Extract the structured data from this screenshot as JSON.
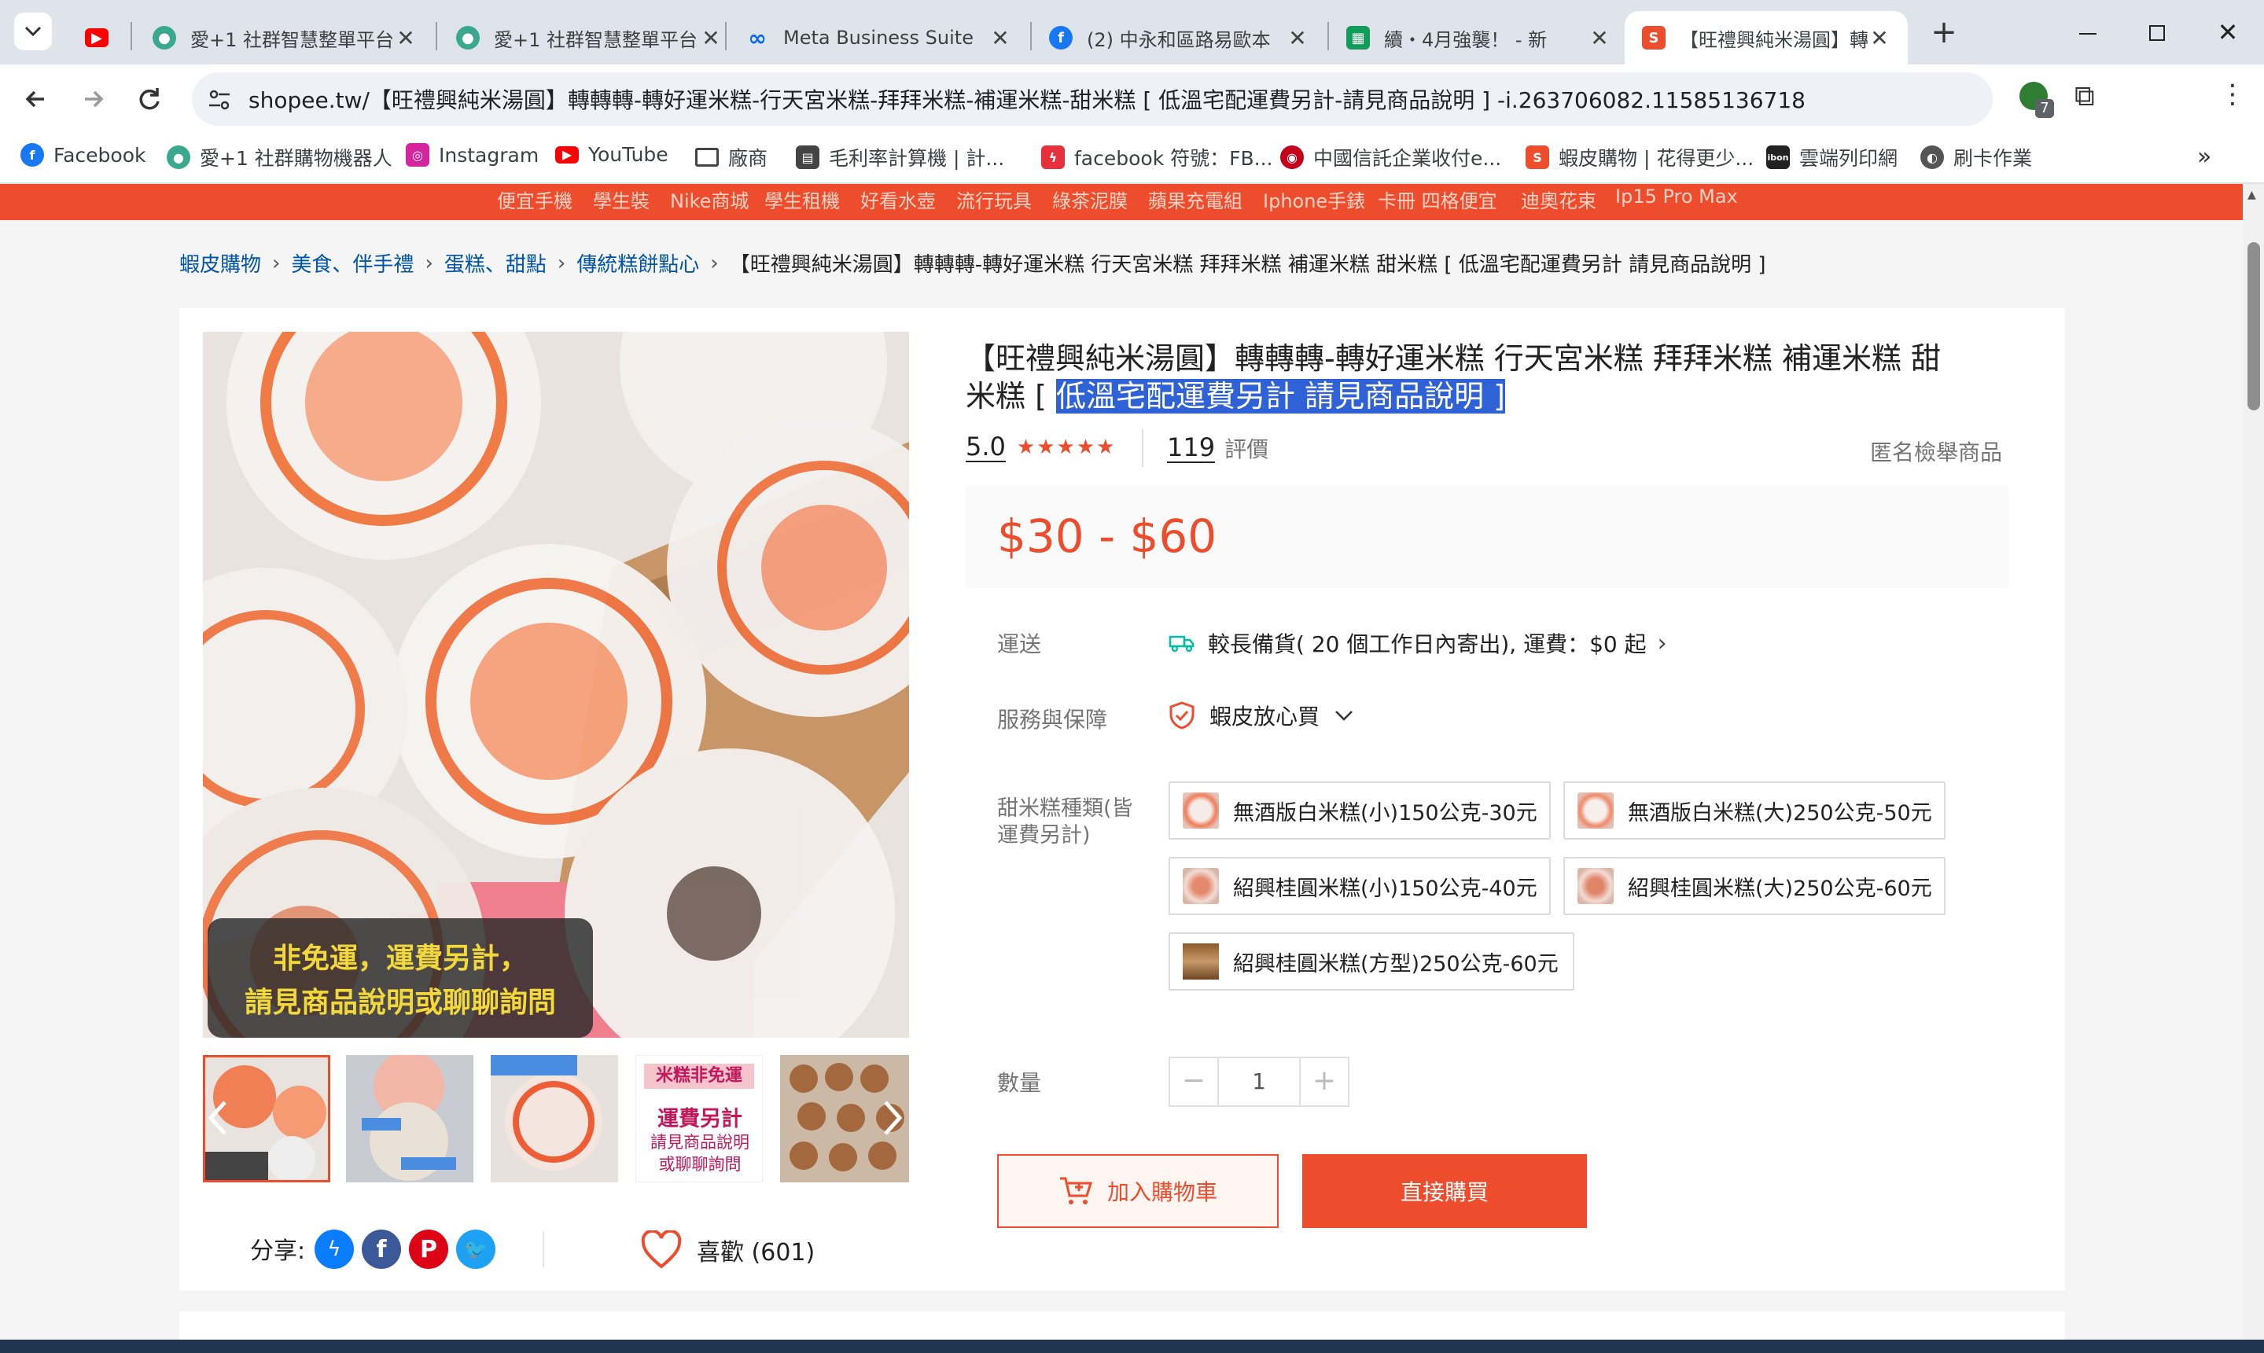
{
  "browser": {
    "tabs": [
      {
        "title": "",
        "favicon": "youtube-icon",
        "color": "#ff0000"
      },
      {
        "title": "愛+1 社群智慧整單平台",
        "favicon": "globe-icon",
        "color": "#3aa88e"
      },
      {
        "title": "愛+1 社群智慧整單平台",
        "favicon": "globe-icon",
        "color": "#3aa88e"
      },
      {
        "title": "Meta Business Suite",
        "favicon": "meta-icon",
        "color": "#0866ff"
      },
      {
        "title": "(2) 中永和區路易歐本",
        "favicon": "facebook-icon",
        "color": "#1877f2"
      },
      {
        "title": "續・4月強襲！ - 新",
        "favicon": "sheets-icon",
        "color": "#0f9d58"
      },
      {
        "title": "【旺禮興純米湯圓】轉",
        "favicon": "shopee-icon",
        "color": "#ee4d2d"
      }
    ],
    "url": "shopee.tw/【旺禮興純米湯圓】轉轉轉-轉好運米糕-行天宮米糕-拜拜米糕-補運米糕-甜米糕 [ 低溫宅配運費另計-請見商品說明 ] -i.263706082.11585136718",
    "extension_badge": "7",
    "bookmarks": [
      {
        "label": "Facebook",
        "icon": "facebook-icon",
        "color": "#1877f2"
      },
      {
        "label": "愛+1 社群購物機器人",
        "icon": "globe-icon",
        "color": "#3aa88e"
      },
      {
        "label": "Instagram",
        "icon": "instagram-icon",
        "color": "#d6249f"
      },
      {
        "label": "YouTube",
        "icon": "youtube-icon",
        "color": "#ff0000"
      },
      {
        "label": "廠商",
        "icon": "folder-icon",
        "color": "#5f6368"
      },
      {
        "label": "毛利率計算機 | 計...",
        "icon": "calculator-icon",
        "color": "#444"
      },
      {
        "label": "facebook 符號：FB...",
        "icon": "flash-icon",
        "color": "#e8303c"
      },
      {
        "label": "中國信託企業收付e...",
        "icon": "ctbc-icon",
        "color": "#c4001d"
      },
      {
        "label": "蝦皮購物 | 花得更少...",
        "icon": "shopee-icon",
        "color": "#ee4d2d"
      },
      {
        "label": "雲端列印網",
        "icon": "ibon-icon",
        "color": "#222"
      },
      {
        "label": "刷卡作業",
        "icon": "card-icon",
        "color": "#555"
      }
    ]
  },
  "top_keywords": [
    "便宜手機",
    "學生裝",
    "Nike商城",
    "學生租機",
    "好看水壺",
    "流行玩具",
    "綠茶泥膜",
    "蘋果充電組",
    "Iphone手錶",
    "卡冊 四格便宜",
    "迪奧花束",
    "Ip15 Pro Max"
  ],
  "breadcrumb": [
    "蝦皮購物",
    "美食、伴手禮",
    "蛋糕、甜點",
    "傳統糕餅點心",
    "【旺禮興純米湯圓】轉轉轉-轉好運米糕 行天宮米糕 拜拜米糕 補運米糕 甜米糕 [ 低溫宅配運費另計 請見商品說明 ]"
  ],
  "product": {
    "title_line1": "【旺禮興純米湯圓】轉轉轉-轉好運米糕 行天宮米糕 拜拜米糕 補運米糕 甜",
    "title_line2_prefix": "米糕 [ ",
    "title_highlight": "低溫宅配運費另計 請見商品說明 ]",
    "rating": "5.0",
    "rating_stars": 5,
    "reviews_count": "119",
    "reviews_label": "評價",
    "report_label": "匿名檢舉商品",
    "price": "$30 - $60",
    "image_overlay_line1": "非免運，運費另計，",
    "image_overlay_line2": "請見商品說明或聊聊詢問",
    "thumb4_line1": "米糕非免運",
    "thumb4_line2": "運費另計",
    "thumb4_line3": "請見商品說明",
    "thumb4_line4": "或聊聊詢問",
    "shipping_label": "運送",
    "shipping_text": "較長備貨( 20 個工作日內寄出), 運費：$0 起",
    "service_label": "服務與保障",
    "service_text": "蝦皮放心買",
    "variant_label_line1": "甜米糕種類(皆",
    "variant_label_line2": "運費另計)",
    "variants": [
      "無酒版白米糕(小)150公克-30元",
      "無酒版白米糕(大)250公克-50元",
      "紹興桂圓米糕(小)150公克-40元",
      "紹興桂圓米糕(大)250公克-60元",
      "紹興桂圓米糕(方型)250公克-60元"
    ],
    "quantity_label": "數量",
    "quantity": "1",
    "add_to_cart": "加入購物車",
    "buy_now": "直接購買",
    "share_label": "分享:",
    "like_label": "喜歡 (601)"
  },
  "colors": {
    "shopee_orange": "#ee4d2d",
    "link_blue": "#05a",
    "star": "#ee4d2d"
  }
}
